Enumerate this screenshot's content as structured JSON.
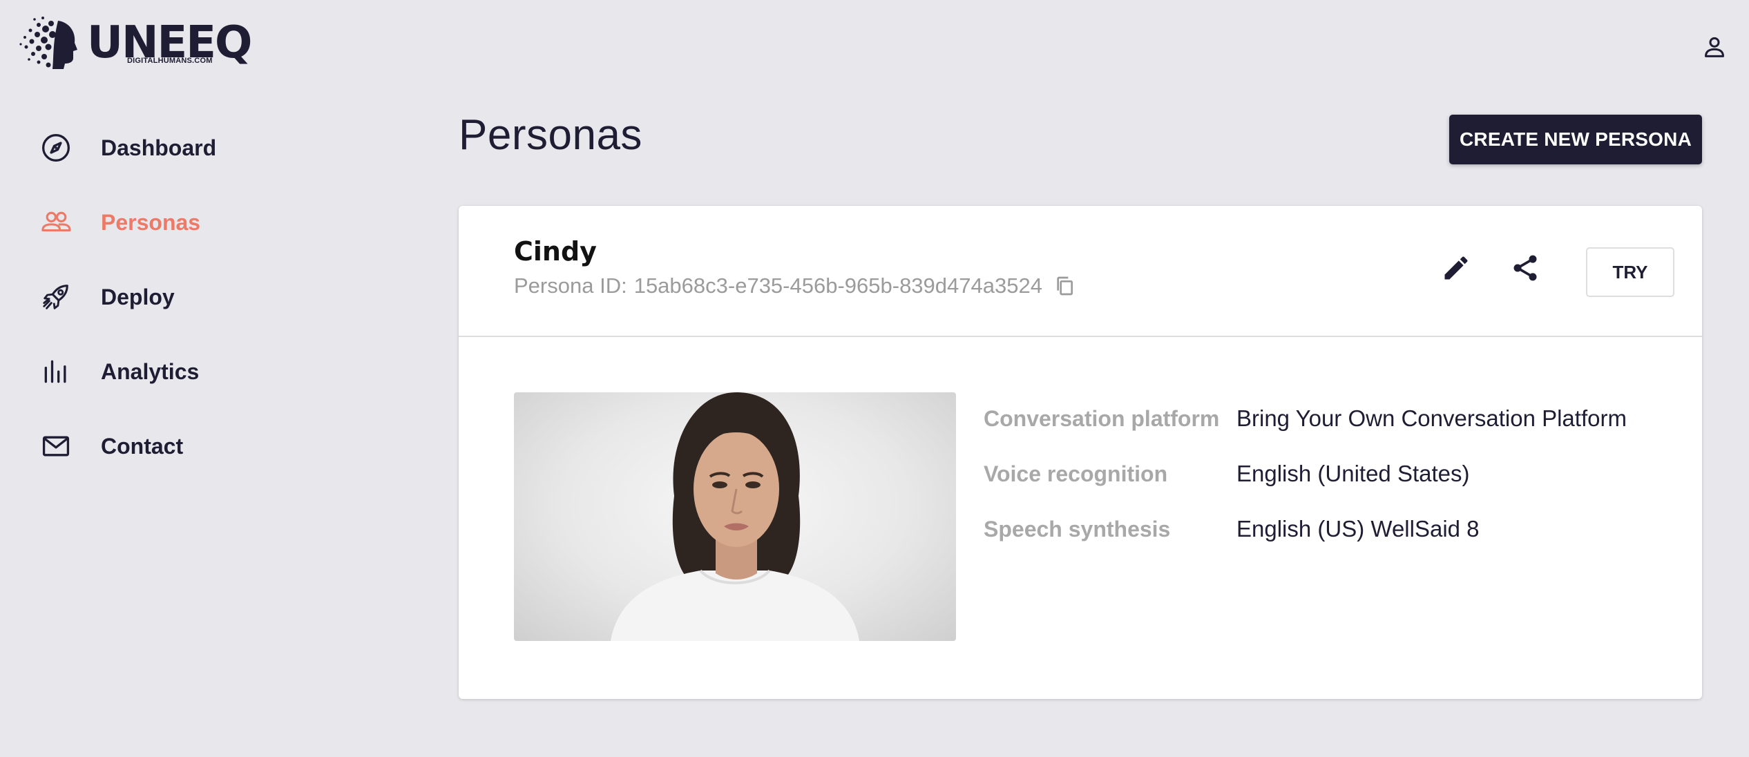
{
  "brand": {
    "name": "UNEEQ",
    "tagline": "DIGITALHUMANS.COM"
  },
  "header": {
    "account_icon": "person-outline-icon"
  },
  "sidebar": {
    "items": [
      {
        "label": "Dashboard",
        "icon": "compass-icon",
        "active": false
      },
      {
        "label": "Personas",
        "icon": "people-outline-icon",
        "active": true
      },
      {
        "label": "Deploy",
        "icon": "rocket-icon",
        "active": false
      },
      {
        "label": "Analytics",
        "icon": "bar-chart-icon",
        "active": false
      },
      {
        "label": "Contact",
        "icon": "mail-icon",
        "active": false
      }
    ],
    "active_color": "#ec7a66"
  },
  "main": {
    "title": "Personas",
    "create_button_label": "CREATE NEW PERSONA"
  },
  "persona": {
    "name": "Cindy",
    "id_label": "Persona ID:",
    "id_value": "15ab68c3-e735-456b-965b-839d474a3524",
    "try_label": "TRY",
    "details": [
      {
        "label": "Conversation platform",
        "value": "Bring Your Own Conversation Platform"
      },
      {
        "label": "Voice recognition",
        "value": "English (United States)"
      },
      {
        "label": "Speech synthesis",
        "value": "English (US) WellSaid 8"
      }
    ]
  },
  "colors": {
    "background": "#e7e7ec",
    "primary_dark": "#1f1d33",
    "accent": "#ec7a66",
    "muted_text": "#9b9b9b"
  }
}
